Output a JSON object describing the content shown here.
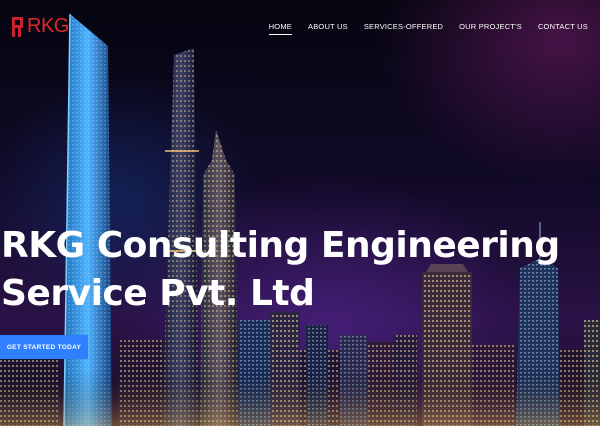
{
  "brand": {
    "logo_text": "RKG"
  },
  "nav": {
    "items": [
      {
        "label": "HOME",
        "active": true
      },
      {
        "label": "ABOUT US",
        "active": false
      },
      {
        "label": "SERVICES-OFFERED",
        "active": false
      },
      {
        "label": "OUR PROJECT'S",
        "active": false
      },
      {
        "label": "CONTACT US",
        "active": false
      }
    ]
  },
  "hero": {
    "title_line1": "RKG Consulting Engineering",
    "title_line2": "Service Pvt. Ltd",
    "cta_label": "GET STARTED TODAY",
    "background": "night-city-skyline-image"
  },
  "colors": {
    "accent": "#2f80ff",
    "brand_red": "#e0262e",
    "nav_text": "#ffffff"
  }
}
